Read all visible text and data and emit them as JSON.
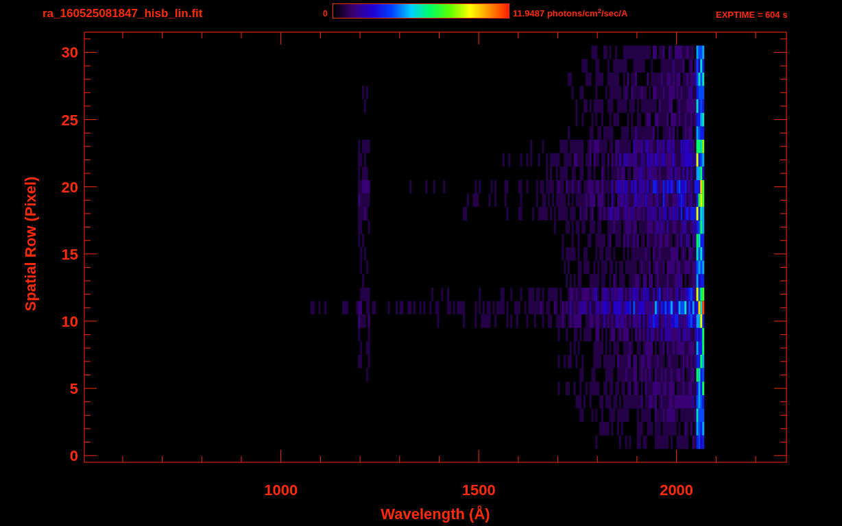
{
  "header": {
    "filename": "ra_160525081847_hisb_lin.fit",
    "colorbar_min": "0",
    "colorbar_max": "11.9487 photons/cm$^{2}$/sec/A",
    "exposure": "EXPTIME = 604 s"
  },
  "plot": {
    "xlabel": "Wavelength (Å)",
    "ylabel": "Spatial Row (Pixel)",
    "xtick_labels": [
      "1000",
      "1500",
      "2000"
    ],
    "ytick_labels": [
      "30",
      "25",
      "20",
      "15",
      "10",
      "5",
      "0"
    ]
  }
}
